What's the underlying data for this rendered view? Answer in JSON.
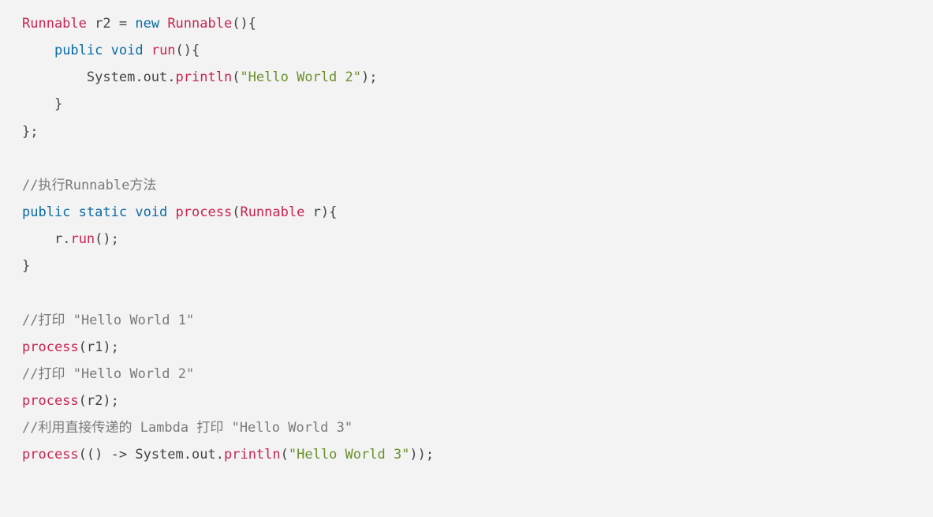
{
  "code": {
    "tokens": [
      [
        {
          "t": "Runnable ",
          "c": "type"
        },
        {
          "t": "r2 ",
          "c": "id"
        },
        {
          "t": "=",
          "c": "pn"
        },
        {
          "t": " ",
          "c": "pn"
        },
        {
          "t": "new",
          "c": "kw"
        },
        {
          "t": " ",
          "c": "pn"
        },
        {
          "t": "Runnable",
          "c": "type"
        },
        {
          "t": "(){",
          "c": "pn"
        }
      ],
      [
        {
          "t": "    ",
          "c": "pn"
        },
        {
          "t": "public",
          "c": "kw"
        },
        {
          "t": " ",
          "c": "pn"
        },
        {
          "t": "void",
          "c": "kw"
        },
        {
          "t": " ",
          "c": "pn"
        },
        {
          "t": "run",
          "c": "type"
        },
        {
          "t": "(){",
          "c": "pn"
        }
      ],
      [
        {
          "t": "        ",
          "c": "pn"
        },
        {
          "t": "System",
          "c": "id"
        },
        {
          "t": ".",
          "c": "pn"
        },
        {
          "t": "out",
          "c": "id"
        },
        {
          "t": ".",
          "c": "pn"
        },
        {
          "t": "println",
          "c": "type"
        },
        {
          "t": "(",
          "c": "pn"
        },
        {
          "t": "\"Hello World 2\"",
          "c": "str"
        },
        {
          "t": ");",
          "c": "pn"
        }
      ],
      [
        {
          "t": "    }",
          "c": "pn"
        }
      ],
      [
        {
          "t": "};",
          "c": "pn"
        }
      ],
      [
        {
          "t": "",
          "c": "pn"
        }
      ],
      [
        {
          "t": "//执行Runnable方法",
          "c": "cmt"
        }
      ],
      [
        {
          "t": "public",
          "c": "kw"
        },
        {
          "t": " ",
          "c": "pn"
        },
        {
          "t": "static",
          "c": "kw"
        },
        {
          "t": " ",
          "c": "pn"
        },
        {
          "t": "void",
          "c": "kw"
        },
        {
          "t": " ",
          "c": "pn"
        },
        {
          "t": "process",
          "c": "type"
        },
        {
          "t": "(",
          "c": "pn"
        },
        {
          "t": "Runnable ",
          "c": "type"
        },
        {
          "t": "r",
          "c": "id"
        },
        {
          "t": "){",
          "c": "pn"
        }
      ],
      [
        {
          "t": "    ",
          "c": "pn"
        },
        {
          "t": "r",
          "c": "id"
        },
        {
          "t": ".",
          "c": "pn"
        },
        {
          "t": "run",
          "c": "type"
        },
        {
          "t": "();",
          "c": "pn"
        }
      ],
      [
        {
          "t": "}",
          "c": "pn"
        }
      ],
      [
        {
          "t": "",
          "c": "pn"
        }
      ],
      [
        {
          "t": "//打印 \"Hello World 1\"",
          "c": "cmt"
        }
      ],
      [
        {
          "t": "process",
          "c": "type"
        },
        {
          "t": "(",
          "c": "pn"
        },
        {
          "t": "r1",
          "c": "id"
        },
        {
          "t": ");",
          "c": "pn"
        }
      ],
      [
        {
          "t": "//打印 \"Hello World 2\"",
          "c": "cmt"
        }
      ],
      [
        {
          "t": "process",
          "c": "type"
        },
        {
          "t": "(",
          "c": "pn"
        },
        {
          "t": "r2",
          "c": "id"
        },
        {
          "t": ");",
          "c": "pn"
        }
      ],
      [
        {
          "t": "//利用直接传递的 Lambda 打印 \"Hello World 3\"",
          "c": "cmt"
        }
      ],
      [
        {
          "t": "process",
          "c": "type"
        },
        {
          "t": "(() ",
          "c": "pn"
        },
        {
          "t": "->",
          "c": "pn"
        },
        {
          "t": " ",
          "c": "pn"
        },
        {
          "t": "System",
          "c": "id"
        },
        {
          "t": ".",
          "c": "pn"
        },
        {
          "t": "out",
          "c": "id"
        },
        {
          "t": ".",
          "c": "pn"
        },
        {
          "t": "println",
          "c": "type"
        },
        {
          "t": "(",
          "c": "pn"
        },
        {
          "t": "\"Hello World 3\"",
          "c": "str"
        },
        {
          "t": "));",
          "c": "pn"
        }
      ]
    ]
  }
}
